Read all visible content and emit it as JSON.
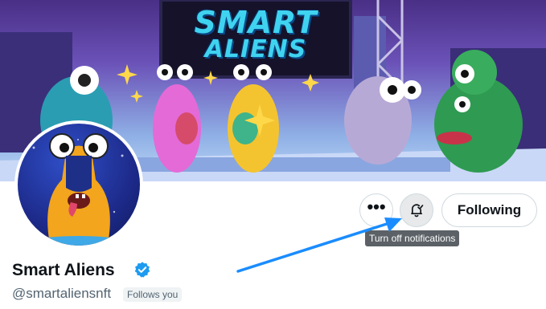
{
  "banner": {
    "sign_line1": "SMART",
    "sign_line2": "ALIENS"
  },
  "profile": {
    "display_name": "Smart Aliens",
    "handle": "@smartaliensnft",
    "follows_you": "Follows you",
    "verified_color": "#1d9bf0"
  },
  "actions": {
    "more": "•••",
    "following_label": "Following",
    "tooltip": "Turn off notifications"
  },
  "annotation": {
    "arrow_color": "#1a8cff"
  }
}
